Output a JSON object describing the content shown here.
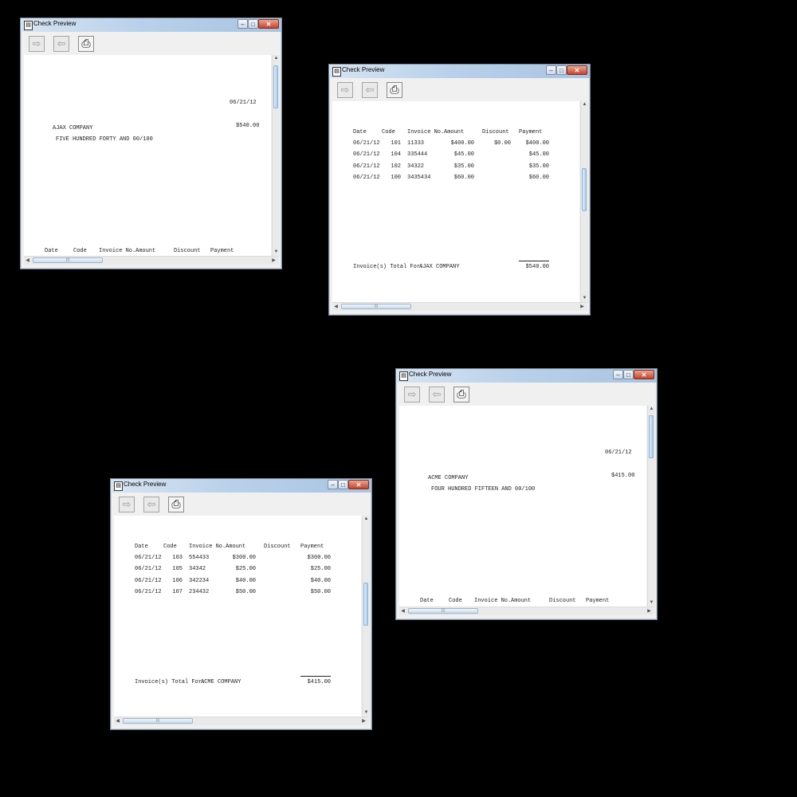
{
  "window_title": "Check Preview",
  "toolbar_icons": [
    "forward-arrow-icon",
    "back-arrow-icon",
    "printer-icon"
  ],
  "columns": {
    "date": "Date",
    "code": "Code",
    "invoice": "Invoice No.",
    "amount": "Amount",
    "discount": "Discount",
    "payment": "Payment"
  },
  "checks": [
    {
      "date": "06/21/12",
      "payee": "AJAX COMPANY",
      "amount": "$540.00",
      "amount_words": "FIVE HUNDRED FORTY AND 00/100"
    },
    {
      "date": "06/21/12",
      "payee": "ACME COMPANY",
      "amount": "$415.00",
      "amount_words": "FOUR HUNDRED FIFTEEN AND 00/100"
    }
  ],
  "stubs": [
    {
      "rows": [
        {
          "date": "06/21/12",
          "code": "101",
          "invoice": "11333",
          "amount": "$400.00",
          "discount": "$0.00",
          "payment": "$400.00"
        },
        {
          "date": "06/21/12",
          "code": "104",
          "invoice": "335444",
          "amount": "$45.00",
          "discount": "",
          "payment": "$45.00"
        },
        {
          "date": "06/21/12",
          "code": "102",
          "invoice": "34322",
          "amount": "$35.00",
          "discount": "",
          "payment": "$35.00"
        },
        {
          "date": "06/21/12",
          "code": "100",
          "invoice": "3435434",
          "amount": "$60.00",
          "discount": "",
          "payment": "$60.00"
        }
      ],
      "total_label": "Invoice(s) Total For:",
      "total_company": "AJAX COMPANY",
      "total": "$540.00"
    },
    {
      "rows": [
        {
          "date": "06/21/12",
          "code": "103",
          "invoice": "554433",
          "amount": "$300.00",
          "discount": "",
          "payment": "$300.00"
        },
        {
          "date": "06/21/12",
          "code": "105",
          "invoice": "34342",
          "amount": "$25.00",
          "discount": "",
          "payment": "$25.00"
        },
        {
          "date": "06/21/12",
          "code": "106",
          "invoice": "342234",
          "amount": "$40.00",
          "discount": "",
          "payment": "$40.00"
        },
        {
          "date": "06/21/12",
          "code": "107",
          "invoice": "234432",
          "amount": "$50.00",
          "discount": "",
          "payment": "$50.00"
        }
      ],
      "total_label": "Invoice(s) Total For:",
      "total_company": "ACME COMPANY",
      "total": "$415.00"
    }
  ]
}
